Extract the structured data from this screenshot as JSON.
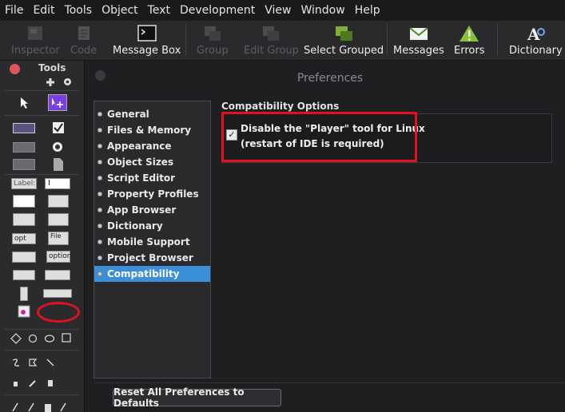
{
  "menu": [
    "File",
    "Edit",
    "Tools",
    "Object",
    "Text",
    "Development",
    "View",
    "Window",
    "Help"
  ],
  "toolbar": {
    "items": [
      {
        "label": "Inspector",
        "icon": "inspector-icon",
        "enabled": false
      },
      {
        "label": "Code",
        "icon": "script-icon",
        "enabled": false
      },
      {
        "label": "Message Box",
        "icon": "message-box-icon",
        "enabled": true
      },
      {
        "label": "Group",
        "icon": "group-icon",
        "enabled": false
      },
      {
        "label": "Edit Group",
        "icon": "edit-group-icon",
        "enabled": false
      },
      {
        "label": "Select Grouped",
        "icon": "select-grouped-icon",
        "enabled": true
      },
      {
        "label": "Messages",
        "icon": "envelope-icon",
        "enabled": true
      },
      {
        "label": "Errors",
        "icon": "warning-icon",
        "enabled": true
      },
      {
        "label": "Dictionary",
        "icon": "dictionary-icon",
        "enabled": true
      }
    ]
  },
  "tools": {
    "title": "Tools",
    "widgets": {
      "label": "Label:",
      "field": "I",
      "option": "opt",
      "file": "File",
      "option2": "option"
    }
  },
  "prefs": {
    "title": "Preferences",
    "categories": [
      {
        "label": "General",
        "selected": false
      },
      {
        "label": "Files & Memory",
        "selected": false
      },
      {
        "label": "Appearance",
        "selected": false
      },
      {
        "label": "Object Sizes",
        "selected": false
      },
      {
        "label": "Script Editor",
        "selected": false
      },
      {
        "label": "Property Profiles",
        "selected": false
      },
      {
        "label": "App Browser",
        "selected": false
      },
      {
        "label": "Dictionary",
        "selected": false
      },
      {
        "label": "Mobile Support",
        "selected": false
      },
      {
        "label": "Project Browser",
        "selected": false
      },
      {
        "label": "Compatibility",
        "selected": true
      }
    ],
    "section_title": "Compatibility Options",
    "option_line1": "Disable the \"Player\" tool for Linux",
    "option_line2": "(restart of IDE is required)",
    "option_checked": true,
    "check_mark": "✓",
    "reset_label": "Reset All Preferences to Defaults"
  },
  "colors": {
    "accent": "#3a8fd6",
    "highlight": "#e3101e"
  }
}
